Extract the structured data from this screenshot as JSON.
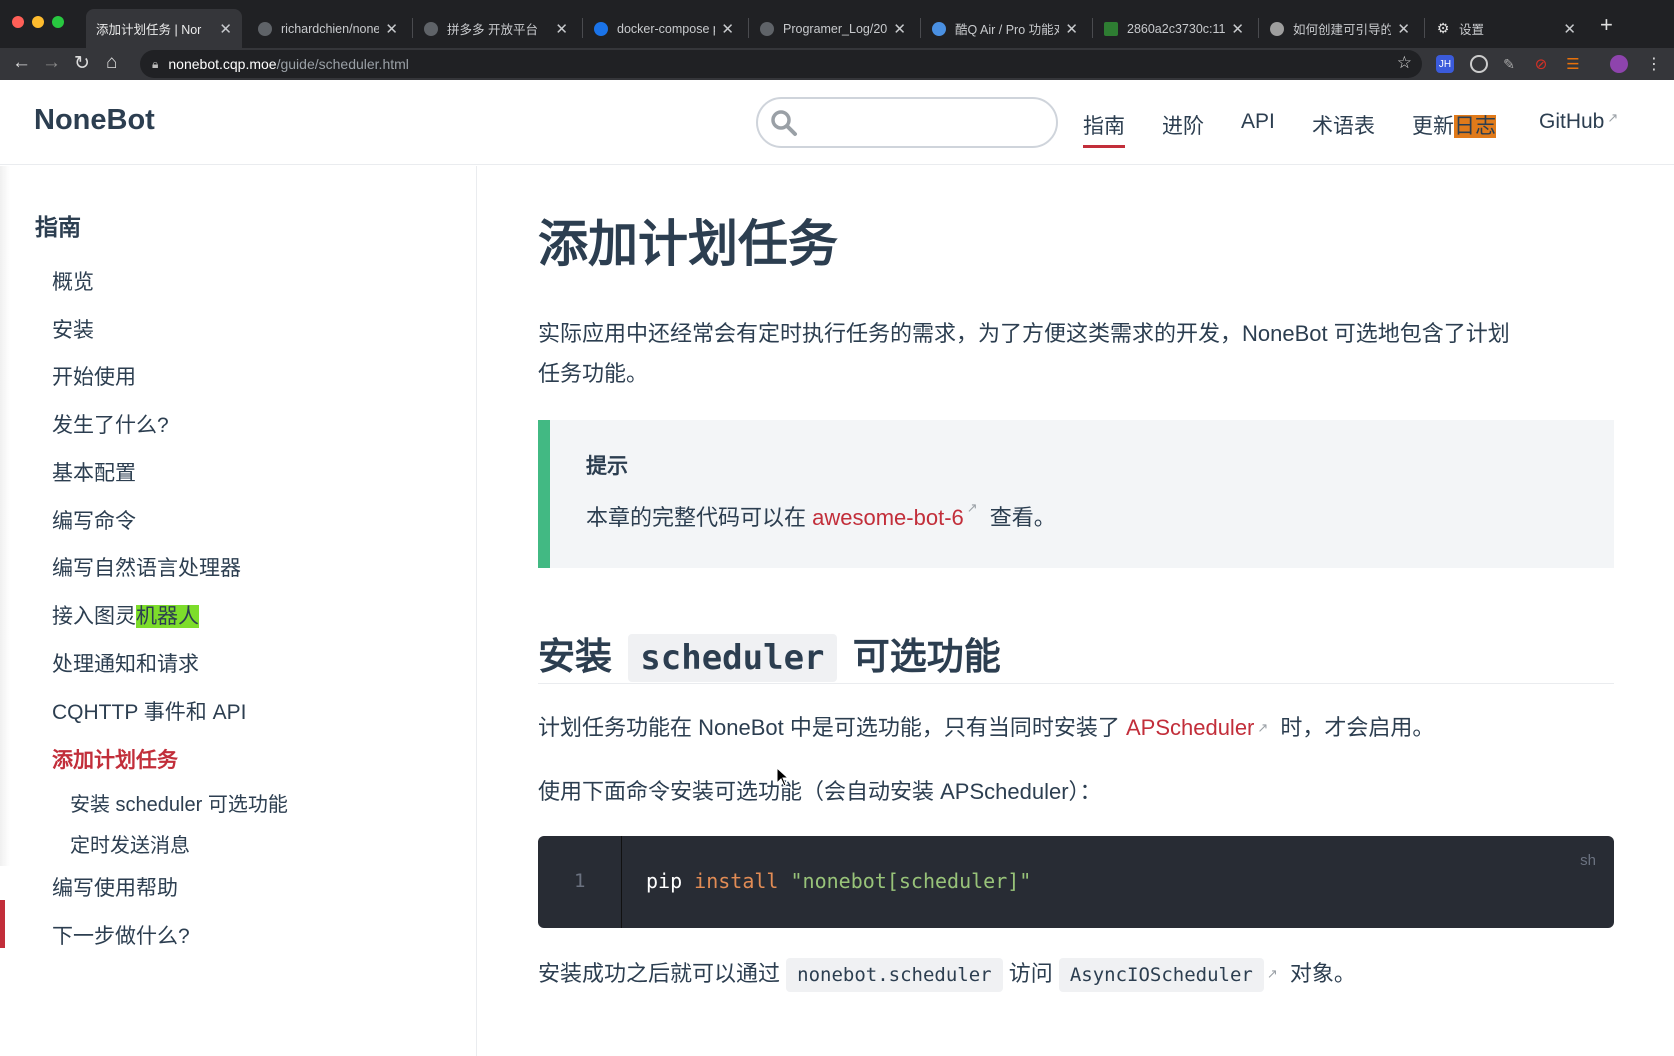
{
  "browser": {
    "tabs": [
      {
        "title": "添加计划任务 | Nor",
        "active": true,
        "favicon_color": "#202124"
      },
      {
        "title": "richardchien/noneb",
        "active": false,
        "favicon_color": "#5f6368"
      },
      {
        "title": "拼多多 开放平台",
        "active": false,
        "favicon_color": "#5f6368"
      },
      {
        "title": "docker-compose p",
        "active": false,
        "favicon_color": "#1a73e8"
      },
      {
        "title": "Programer_Log/20",
        "active": false,
        "favicon_color": "#5f6368"
      },
      {
        "title": "酷Q Air / Pro 功能对",
        "active": false,
        "favicon_color": "#4a90e2"
      },
      {
        "title": "2860a2c3730c:11",
        "active": false,
        "favicon_color": "#2e7d32"
      },
      {
        "title": "如何创建可引导的",
        "active": false,
        "favicon_color": "#9e9e9e"
      },
      {
        "title": "设置",
        "active": false,
        "favicon_color": "#9e9e9e"
      }
    ],
    "url_host": "nonebot.cqp.moe",
    "url_path": "/guide/scheduler.html"
  },
  "header": {
    "logo": "NoneBot",
    "search_placeholder": "",
    "nav": {
      "guide": "指南",
      "advanced": "进阶",
      "api": "API",
      "glossary": "术语表",
      "changelog_a": "更新",
      "changelog_b": "日志",
      "github": "GitHub"
    }
  },
  "sidebar": {
    "title": "指南",
    "items": [
      "概览",
      "安装",
      "开始使用",
      "发生了什么?",
      "基本配置",
      "编写命令",
      "编写自然语言处理器"
    ],
    "turing_a": "接入图灵",
    "turing_b": "机器人",
    "notice": "处理通知和请求",
    "cqhttp": "CQHTTP 事件和 API",
    "active": "添加计划任务",
    "sub": [
      "安装 scheduler 可选功能",
      "定时发送消息"
    ],
    "help": "编写使用帮助",
    "next": "下一步做什么?"
  },
  "content": {
    "title": "添加计划任务",
    "intro_line1": "实际应用中还经常会有定时执行任务的需求，为了方便这类需求的开发，NoneBot 可选地包含了计划",
    "intro_line2": "任务功能。",
    "tip_title": "提示",
    "tip_pre": "本章的完整代码可以在 ",
    "tip_link": "awesome-bot-6",
    "tip_post": " 查看。",
    "h2_a": "安装",
    "h2_code": "scheduler",
    "h2_b": "可选功能",
    "p1_pre": "计划任务功能在 NoneBot 中是可选功能，只有当同时安装了 ",
    "p1_link": "APScheduler",
    "p1_post": " 时，才会启用。",
    "p2": "使用下面命令安装可选功能（会自动安装 APScheduler）：",
    "code_lang": "sh",
    "code_lineno": "1",
    "code_cmd": "pip ",
    "code_kw": "install",
    "code_str": "\"nonebot[scheduler]\"",
    "p3_pre": "安装成功之后就可以通过 ",
    "p3_code1": "nonebot.scheduler",
    "p3_mid": " 访问 ",
    "p3_code2": "AsyncIOScheduler",
    "p3_post": " 对象。"
  },
  "colors": {
    "accent": "#c22e3a",
    "tip_border": "#42b983",
    "highlight_green": "#7ddd2b",
    "highlight_orange": "#e07a1a"
  }
}
